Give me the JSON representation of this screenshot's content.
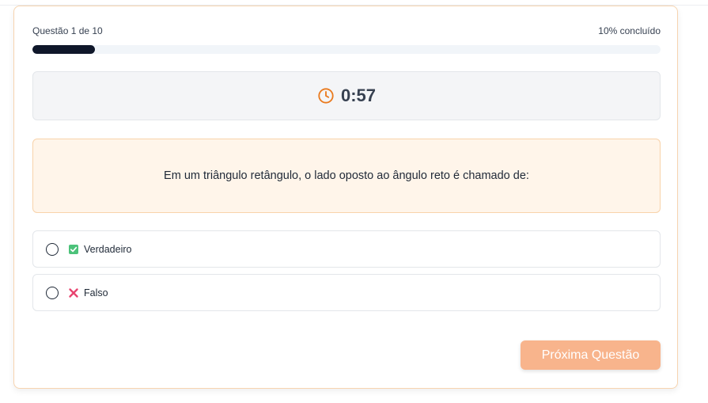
{
  "progress": {
    "label": "Questão 1 de 10",
    "percent_label": "10% concluído",
    "percent": 10
  },
  "timer": {
    "value": "0:57",
    "icon": "clock-icon",
    "icon_color": "#ea7a1e"
  },
  "question": {
    "text": "Em um triângulo retângulo, o lado oposto ao ângulo reto é chamado de:"
  },
  "options": [
    {
      "label": "Verdadeiro",
      "icon": "check-box-icon",
      "icon_color": "#4cc27a"
    },
    {
      "label": "Falso",
      "icon": "cross-icon",
      "icon_color": "#e8446f"
    }
  ],
  "next_button": {
    "label": "Próxima Questão",
    "color": "#f8b48c"
  }
}
